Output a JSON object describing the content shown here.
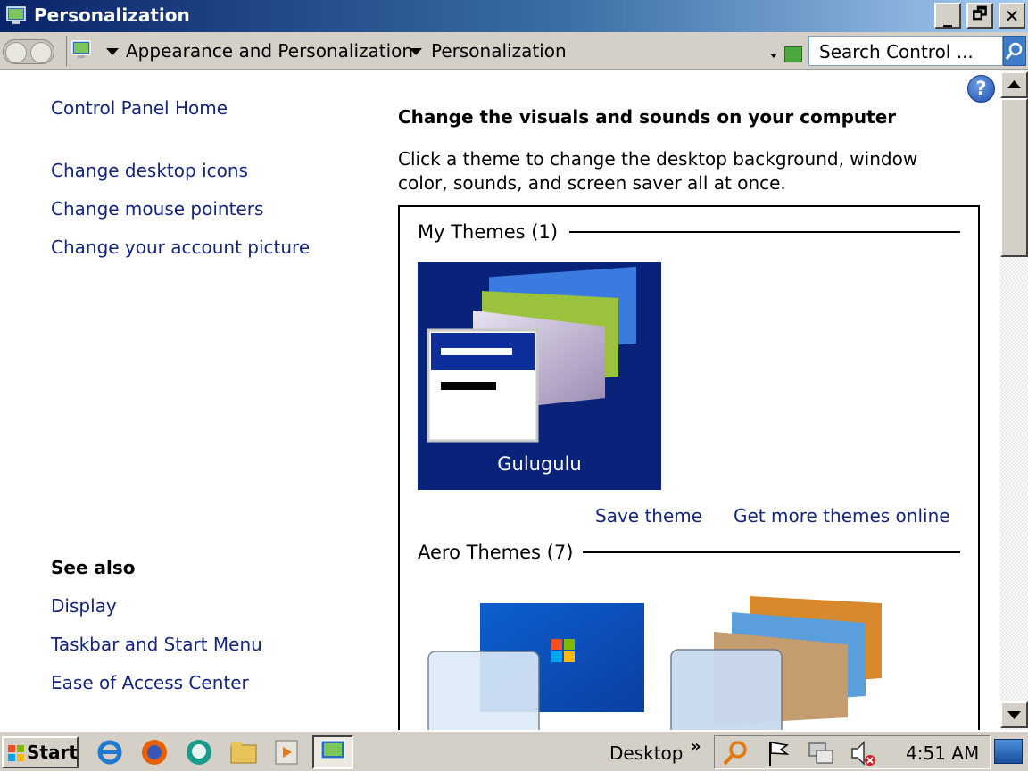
{
  "window": {
    "title": "Personalization",
    "icon": "control-panel-icon",
    "controls": {
      "minimize": "_",
      "maximize": "🗗",
      "close": "✕"
    }
  },
  "address": {
    "breadcrumbs": [
      "Appearance and Personalization",
      "Personalization"
    ],
    "search_placeholder": "Search Control ..."
  },
  "sidebar": {
    "home": "Control Panel Home",
    "tasks": [
      "Change desktop icons",
      "Change mouse pointers",
      "Change your account picture"
    ],
    "see_also_title": "See also",
    "see_also": [
      "Display",
      "Taskbar and Start Menu",
      "Ease of Access Center"
    ]
  },
  "main": {
    "help": "?",
    "title": "Change the visuals and sounds on your computer",
    "description": "Click a theme to change the desktop background, window color, sounds, and screen saver all at once.",
    "my_themes_label": "My Themes (1)",
    "my_theme_name": "Gulugulu",
    "save_theme": "Save theme",
    "get_more": "Get more themes online",
    "aero_label": "Aero Themes (7)"
  },
  "taskbar": {
    "start": "Start",
    "desktop": "Desktop",
    "chevron": "»",
    "time": "4:51 AM",
    "pinned_icons": [
      "internet-explorer-icon",
      "firefox-icon",
      "chat-icon",
      "explorer-icon",
      "media-player-icon",
      "control-panel-icon"
    ],
    "tray_icons": [
      "search-icon",
      "flag-icon",
      "network-icon",
      "volume-muted-icon"
    ]
  },
  "colors": {
    "link": "#14267a",
    "title_gradient_start": "#0a246a",
    "theme_tile_bg": "#0a237a"
  }
}
